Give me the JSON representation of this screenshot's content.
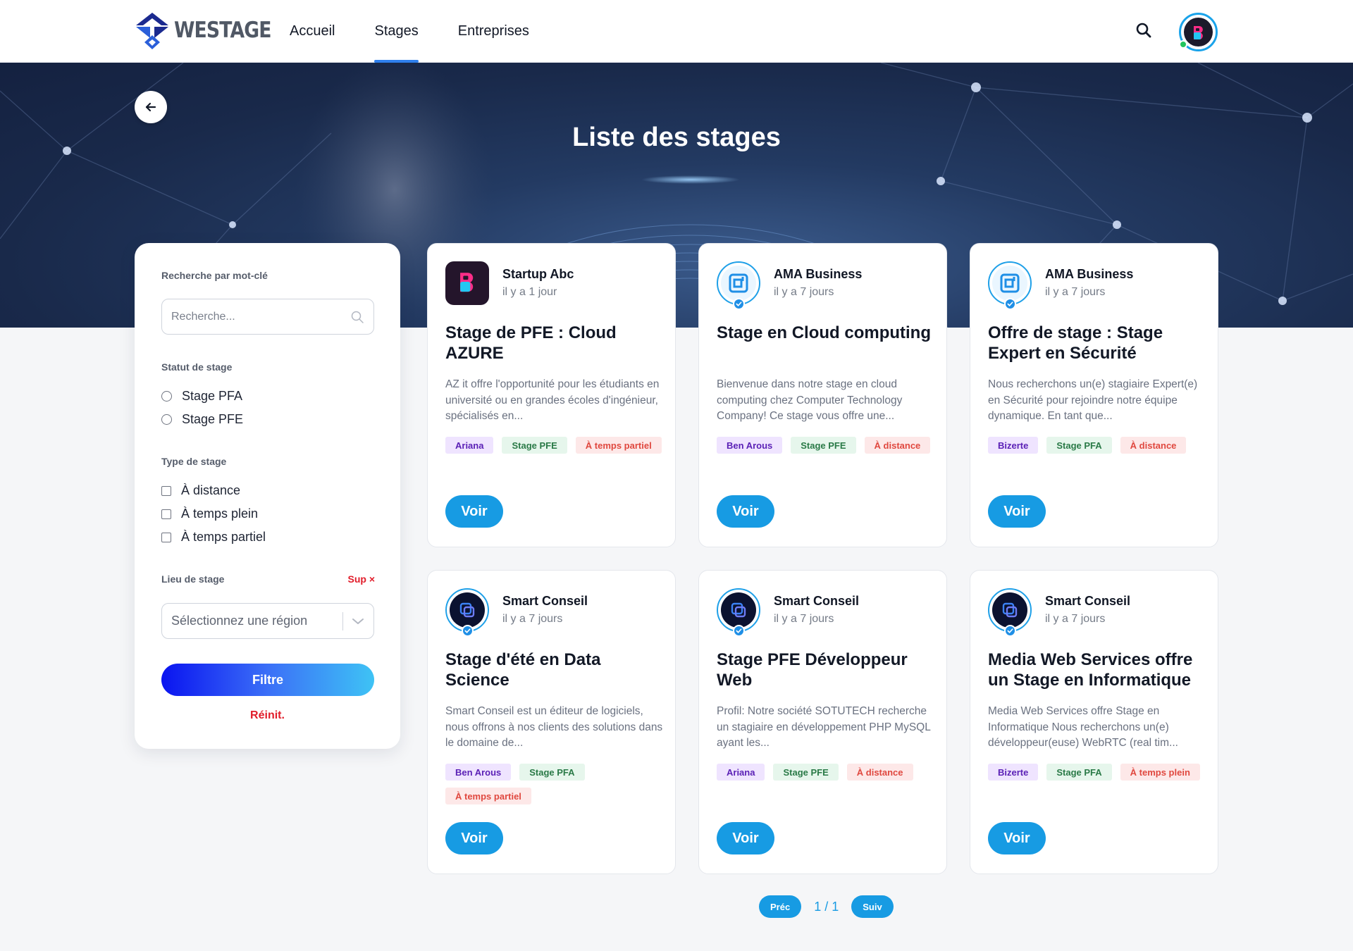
{
  "header": {
    "logo_text": "WESTAGE",
    "nav": [
      {
        "label": "Accueil",
        "active": false
      },
      {
        "label": "Stages",
        "active": true
      },
      {
        "label": "Entreprises",
        "active": false
      }
    ],
    "search_icon": "search-icon",
    "avatar_icon": "user-avatar",
    "accent_color": "#2f80ed"
  },
  "hero": {
    "title": "Liste des stages",
    "back_icon": "arrow-left-icon"
  },
  "filters": {
    "keyword_label": "Recherche par mot-clé",
    "search_placeholder": "Recherche...",
    "status_label": "Statut de stage",
    "status_options": [
      "Stage PFA",
      "Stage PFE"
    ],
    "type_label": "Type de stage",
    "type_options": [
      "À distance",
      "À temps plein",
      "À temps partiel"
    ],
    "location_label": "Lieu de stage",
    "clear_label": "Sup ×",
    "region_placeholder": "Sélectionnez une région",
    "filter_button": "Filtre",
    "reset_label": "Réinit."
  },
  "cards": [
    {
      "company": "Startup Abc",
      "ago": "il y a 1 jour",
      "logo": "startup",
      "title": "Stage de PFE : Cloud AZURE",
      "description": "AZ it offre l'opportunité pour les étudiants en université ou en grandes écoles d'ingénieur, spécialisés en...",
      "tags": [
        {
          "text": "Ariana",
          "kind": "loc"
        },
        {
          "text": "Stage PFE",
          "kind": "type"
        },
        {
          "text": "À temps partiel",
          "kind": "mode"
        }
      ],
      "button": "Voir"
    },
    {
      "company": "AMA Business",
      "ago": "il y a 7 jours",
      "logo": "ama",
      "title": "Stage en Cloud computing",
      "description": "Bienvenue dans notre stage en cloud computing chez Computer Technology Company! Ce stage vous offre une...",
      "tags": [
        {
          "text": "Ben Arous",
          "kind": "loc"
        },
        {
          "text": "Stage PFE",
          "kind": "type"
        },
        {
          "text": "À distance",
          "kind": "mode"
        }
      ],
      "button": "Voir"
    },
    {
      "company": "AMA Business",
      "ago": "il y a 7 jours",
      "logo": "ama",
      "title": "Offre de stage : Stage Expert en Sécurité",
      "description": "Nous recherchons un(e) stagiaire Expert(e) en Sécurité pour rejoindre notre équipe dynamique. En tant que...",
      "tags": [
        {
          "text": "Bizerte",
          "kind": "loc"
        },
        {
          "text": "Stage PFA",
          "kind": "type"
        },
        {
          "text": "À distance",
          "kind": "mode"
        }
      ],
      "button": "Voir"
    },
    {
      "company": "Smart Conseil",
      "ago": "il y a 7 jours",
      "logo": "smart",
      "title": "Stage d'été en Data Science",
      "description": "Smart Conseil est un éditeur de logiciels, nous offrons à nos clients des solutions dans le domaine de...",
      "tags": [
        {
          "text": "Ben Arous",
          "kind": "loc"
        },
        {
          "text": "Stage PFA",
          "kind": "type"
        },
        {
          "text": "À temps partiel",
          "kind": "mode"
        }
      ],
      "button": "Voir"
    },
    {
      "company": "Smart Conseil",
      "ago": "il y a 7 jours",
      "logo": "smart",
      "title": "Stage PFE Développeur Web",
      "description": "Profil: Notre société SOTUTECH recherche un stagiaire en développement PHP MySQL ayant les...",
      "tags": [
        {
          "text": "Ariana",
          "kind": "loc"
        },
        {
          "text": "Stage PFE",
          "kind": "type"
        },
        {
          "text": "À distance",
          "kind": "mode"
        }
      ],
      "button": "Voir"
    },
    {
      "company": "Smart Conseil",
      "ago": "il y a 7 jours",
      "logo": "smart",
      "title": "Media Web Services offre un Stage en Informatique",
      "description": "Media Web Services offre Stage en Informatique Nous recherchons un(e) développeur(euse) WebRTC (real tim...",
      "tags": [
        {
          "text": "Bizerte",
          "kind": "loc"
        },
        {
          "text": "Stage PFA",
          "kind": "type"
        },
        {
          "text": "À temps plein",
          "kind": "mode"
        }
      ],
      "button": "Voir"
    }
  ],
  "pagination": {
    "prev": "Préc",
    "count": "1 / 1",
    "next": "Suiv"
  }
}
